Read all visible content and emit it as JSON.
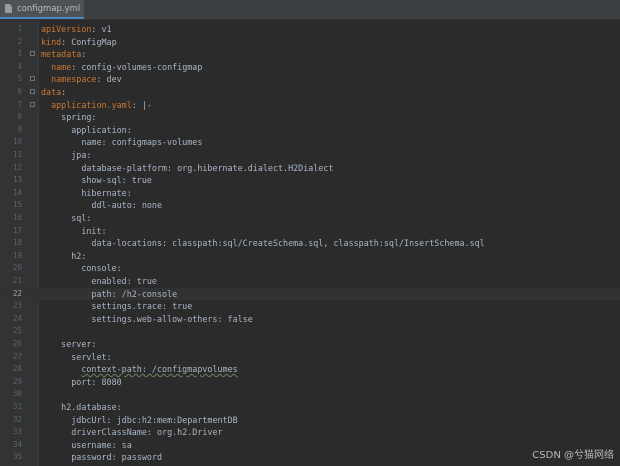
{
  "tab": {
    "label": "configmap.yml"
  },
  "editor": {
    "current_line": "22",
    "lines": [
      {
        "num": "1",
        "indent": "",
        "key": "apiVersion",
        "sep": ": ",
        "value": "v1",
        "fold": false
      },
      {
        "num": "2",
        "indent": "",
        "key": "kind",
        "sep": ": ",
        "value": "ConfigMap",
        "fold": false
      },
      {
        "num": "3",
        "indent": "",
        "key": "metadata",
        "sep": ":",
        "value": "",
        "fold": true
      },
      {
        "num": "4",
        "indent": "  ",
        "key": "name",
        "sep": ": ",
        "value": "config-volumes-configmap",
        "fold": false
      },
      {
        "num": "5",
        "indent": "  ",
        "key": "namespace",
        "sep": ": ",
        "value": "dev",
        "fold": true
      },
      {
        "num": "6",
        "indent": "",
        "key": "data",
        "sep": ":",
        "value": "",
        "fold": true
      },
      {
        "num": "7",
        "indent": "  ",
        "key": "application.yaml",
        "sep": ": ",
        "value": "|-",
        "fold": true
      },
      {
        "num": "8",
        "indent": "    ",
        "key": "",
        "sep": "",
        "value": "spring:",
        "fold": false
      },
      {
        "num": "9",
        "indent": "      ",
        "key": "",
        "sep": "",
        "value": "application:",
        "fold": false
      },
      {
        "num": "10",
        "indent": "        ",
        "key": "",
        "sep": "",
        "value": "name: configmaps-volumes",
        "fold": false
      },
      {
        "num": "11",
        "indent": "      ",
        "key": "",
        "sep": "",
        "value": "jpa:",
        "fold": false
      },
      {
        "num": "12",
        "indent": "        ",
        "key": "",
        "sep": "",
        "value": "database-platform: org.hibernate.dialect.H2Dialect",
        "fold": false
      },
      {
        "num": "13",
        "indent": "        ",
        "key": "",
        "sep": "",
        "value": "show-sql: true",
        "fold": false
      },
      {
        "num": "14",
        "indent": "        ",
        "key": "",
        "sep": "",
        "value": "hibernate:",
        "fold": false
      },
      {
        "num": "15",
        "indent": "          ",
        "key": "",
        "sep": "",
        "value": "ddl-auto: none",
        "fold": false
      },
      {
        "num": "16",
        "indent": "      ",
        "key": "",
        "sep": "",
        "value": "sql:",
        "fold": false
      },
      {
        "num": "17",
        "indent": "        ",
        "key": "",
        "sep": "",
        "value": "init:",
        "fold": false
      },
      {
        "num": "18",
        "indent": "          ",
        "key": "",
        "sep": "",
        "value": "data-locations: classpath:sql/CreateSchema.sql, classpath:sql/InsertSchema.sql",
        "fold": false
      },
      {
        "num": "19",
        "indent": "      ",
        "key": "",
        "sep": "",
        "value": "h2:",
        "fold": false
      },
      {
        "num": "20",
        "indent": "        ",
        "key": "",
        "sep": "",
        "value": "console:",
        "fold": false
      },
      {
        "num": "21",
        "indent": "          ",
        "key": "",
        "sep": "",
        "value": "enabled: true",
        "fold": false
      },
      {
        "num": "22",
        "indent": "          ",
        "key": "",
        "sep": "",
        "value": "path: /h2-console",
        "fold": false
      },
      {
        "num": "23",
        "indent": "          ",
        "key": "",
        "sep": "",
        "value": "settings.trace: true",
        "fold": false
      },
      {
        "num": "24",
        "indent": "          ",
        "key": "",
        "sep": "",
        "value": "settings.web-allow-others: false",
        "fold": false
      },
      {
        "num": "25",
        "indent": "",
        "key": "",
        "sep": "",
        "value": "",
        "fold": false
      },
      {
        "num": "26",
        "indent": "    ",
        "key": "",
        "sep": "",
        "value": "server:",
        "fold": false
      },
      {
        "num": "27",
        "indent": "      ",
        "key": "",
        "sep": "",
        "value": "servlet:",
        "fold": false
      },
      {
        "num": "28",
        "indent": "        ",
        "key": "",
        "sep": "",
        "value": "context-path: /configmapvolumes",
        "fold": false
      },
      {
        "num": "29",
        "indent": "      ",
        "key": "",
        "sep": "",
        "value": "port: 8080",
        "fold": false
      },
      {
        "num": "30",
        "indent": "",
        "key": "",
        "sep": "",
        "value": "",
        "fold": false
      },
      {
        "num": "31",
        "indent": "    ",
        "key": "",
        "sep": "",
        "value": "h2.database:",
        "fold": false
      },
      {
        "num": "32",
        "indent": "      ",
        "key": "",
        "sep": "",
        "value": "jdbcUrl: jdbc:h2:mem:DepartmentDB",
        "fold": false
      },
      {
        "num": "33",
        "indent": "      ",
        "key": "",
        "sep": "",
        "value": "driverClassName: org.h2.Driver",
        "fold": false
      },
      {
        "num": "34",
        "indent": "      ",
        "key": "",
        "sep": "",
        "value": "username: sa",
        "fold": false
      },
      {
        "num": "35",
        "indent": "      ",
        "key": "",
        "sep": "",
        "value": "password: password",
        "fold": false
      }
    ]
  },
  "watermark": "CSDN @兮猫网络"
}
